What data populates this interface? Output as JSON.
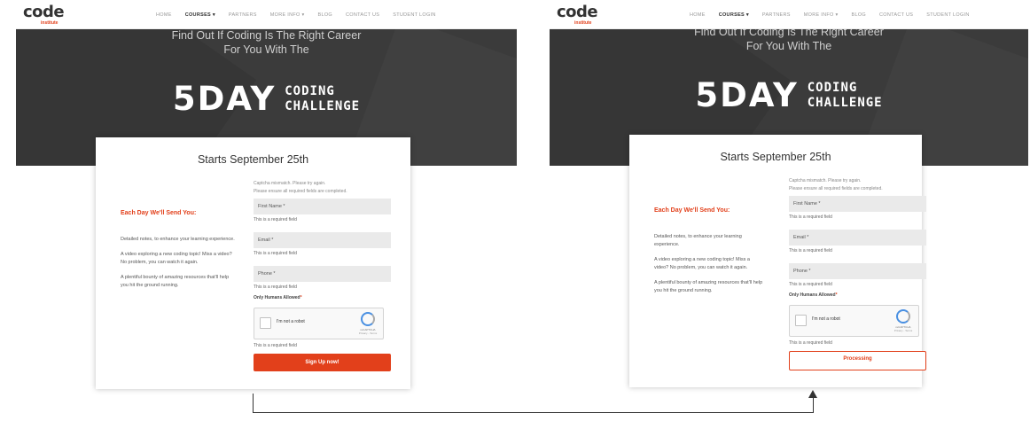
{
  "panels": [
    {
      "logo": "code",
      "logo_sub": "institute",
      "menu": [
        "HOME",
        "COURSES ▾",
        "PARTNERS",
        "MORE INFO ▾",
        "BLOG",
        "CONTACT US",
        "STUDENT LOGIN"
      ],
      "hero_sub": "Find Out If Coding Is The Right Career For You With The",
      "hero_big": "5DAY",
      "hero_small_1": "CODING",
      "hero_small_2": "CHALLENGE",
      "card_title": "Starts September 25th",
      "error_1": "Captcha mismatch. Please try again.",
      "error_2": "Please ensure all required fields are completed.",
      "each_day": "Each Day We'll Send You:",
      "desc_1": "Detailed notes, to enhance your learning experience.",
      "desc_2": "A video exploring a new coding topic! Miss a video? No problem, you can watch it again.",
      "desc_3": "A plentiful bounty of amazing resources that'll help you hit the ground running.",
      "first_name": "First Name *",
      "email": "Email *",
      "phone": "Phone *",
      "required": "This is a required field",
      "humans": "Only Humans Allowed",
      "humans_star": "*",
      "captcha_label": "I'm not a robot",
      "captcha_brand": "reCAPTCHA",
      "captcha_terms": "Privacy - Terms",
      "button": "Sign Up now!"
    },
    {
      "logo": "code",
      "logo_sub": "institute",
      "menu": [
        "HOME",
        "COURSES ▾",
        "PARTNERS",
        "MORE INFO ▾",
        "BLOG",
        "CONTACT US",
        "STUDENT LOGIN"
      ],
      "hero_sub": "Find Out If Coding Is The Right Career For You With The",
      "hero_big": "5DAY",
      "hero_small_1": "CODING",
      "hero_small_2": "CHALLENGE",
      "card_title": "Starts September 25th",
      "error_1": "Captcha mismatch. Please try again.",
      "error_2": "Please ensure all required fields are completed.",
      "each_day": "Each Day We'll Send You:",
      "desc_1": "Detailed notes, to enhance your learning experience.",
      "desc_2": "A video exploring a new coding topic! Miss a video? No problem, you can watch it again.",
      "desc_3": "A plentiful bounty of amazing resources that'll help you hit the ground running.",
      "first_name": "First Name *",
      "email": "Email *",
      "phone": "Phone *",
      "required": "This is a required field",
      "humans": "Only Humans Allowed",
      "humans_star": "*",
      "captcha_label": "I'm not a robot",
      "captcha_brand": "reCAPTCHA",
      "captcha_terms": "Privacy - Terms",
      "button": "Processing"
    }
  ],
  "colors": {
    "accent": "#e2401b",
    "hero_bg": "#3b3b3b",
    "field_bg": "#eaeaea"
  }
}
